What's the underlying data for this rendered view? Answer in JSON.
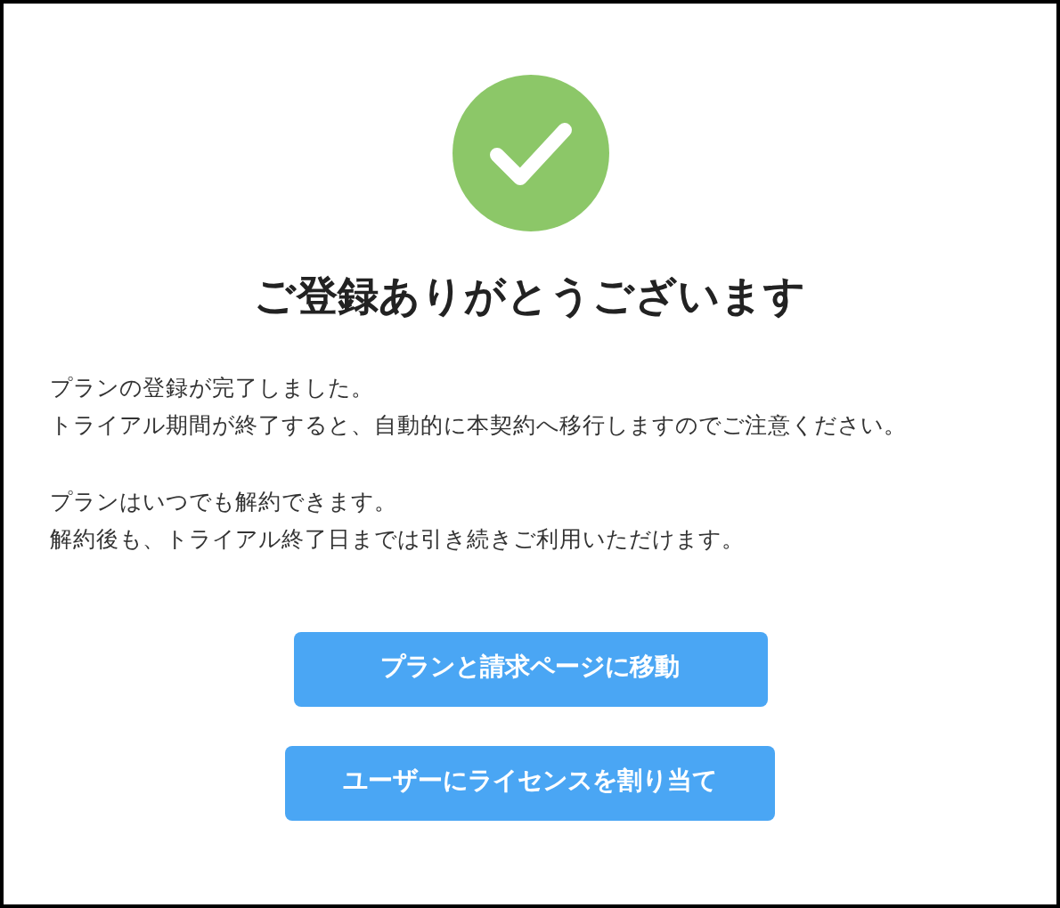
{
  "title": "ご登録ありがとうございます",
  "paragraphs": [
    [
      "プランの登録が完了しました。",
      "トライアル期間が終了すると、自動的に本契約へ移行しますのでご注意ください。"
    ],
    [
      "プランはいつでも解約できます。",
      "解約後も、トライアル終了日までは引き続きご利用いただけます。"
    ]
  ],
  "buttons": [
    "プランと請求ページに移動",
    "ユーザーにライセンスを割り当て"
  ]
}
